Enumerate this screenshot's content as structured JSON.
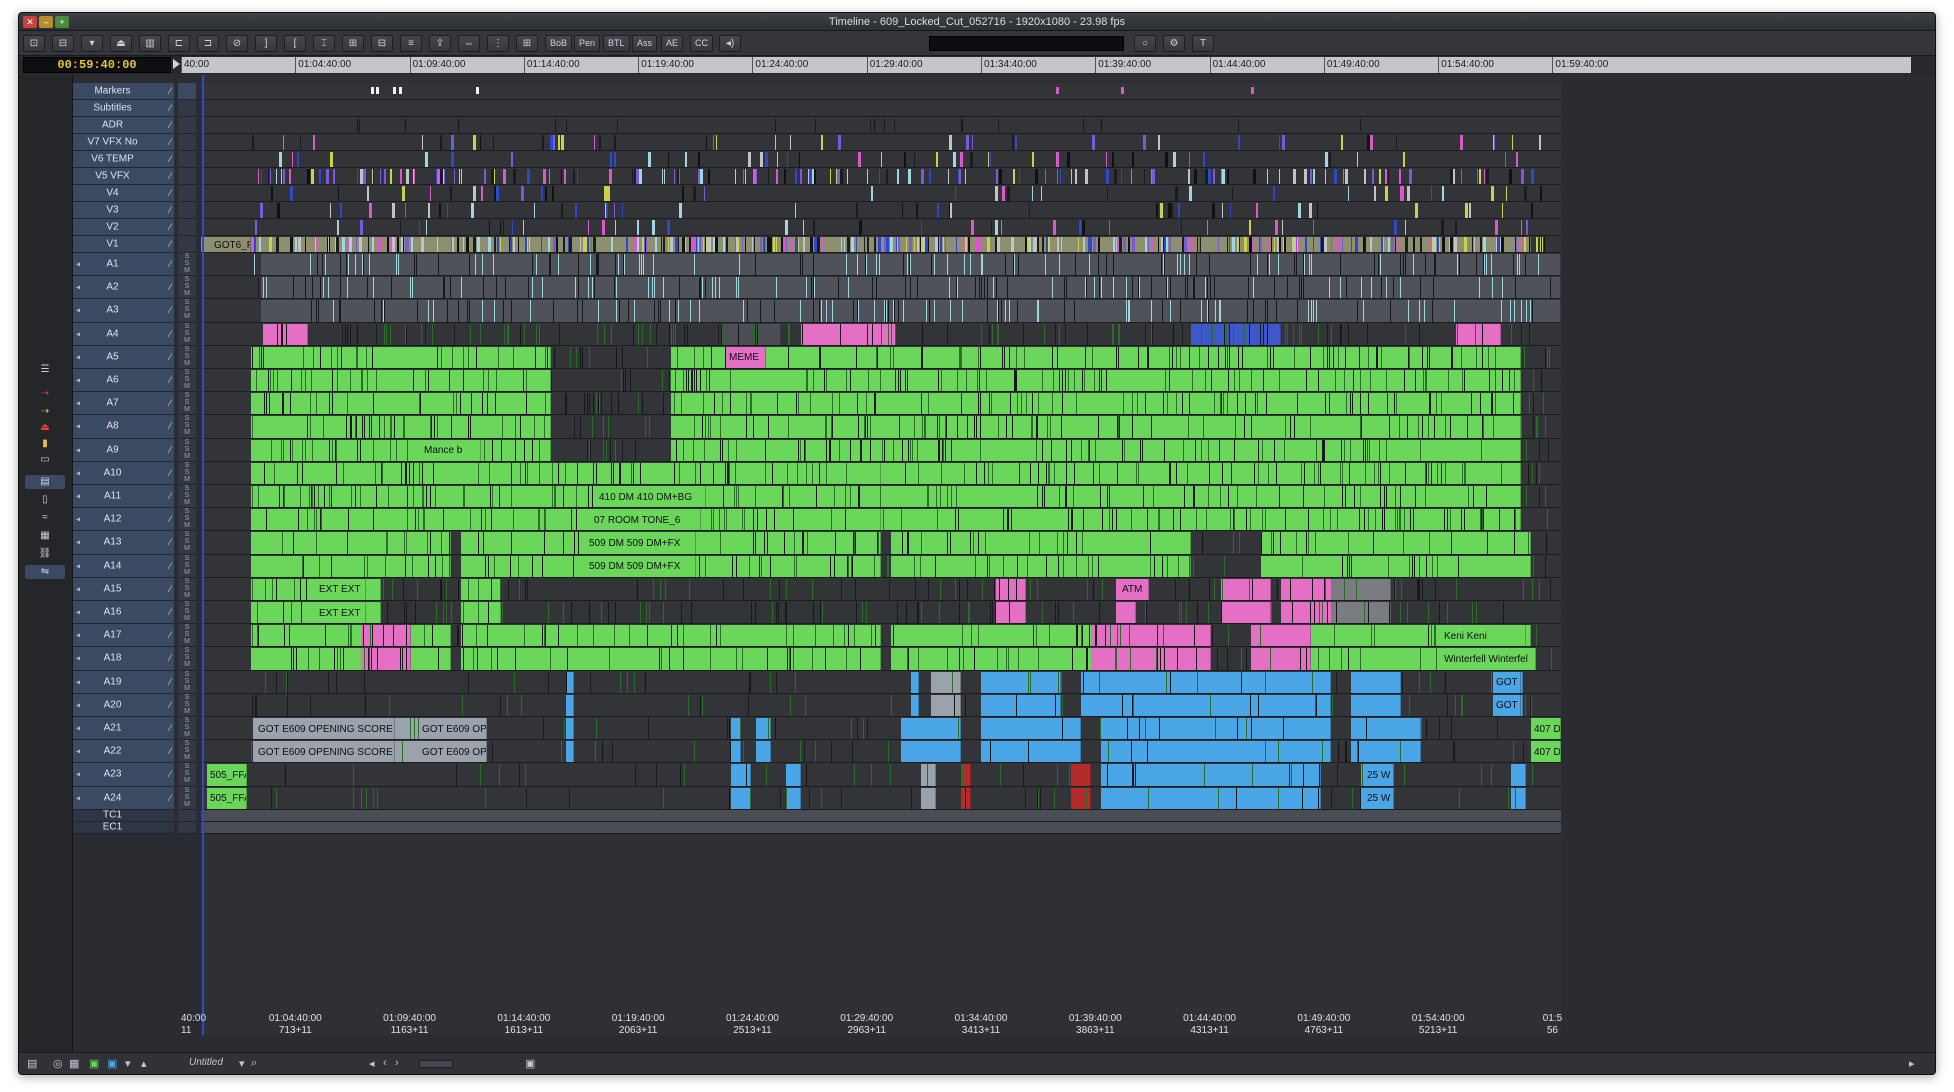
{
  "window": {
    "title": "Timeline - 609_Locked_Cut_052716 - 1920x1080 - 23.98 fps"
  },
  "toolbar": {
    "buttons": [
      {
        "icon": "record-icon"
      },
      {
        "icon": "source-icon"
      },
      {
        "icon": "dropdown-icon"
      },
      {
        "icon": "eject-icon"
      },
      {
        "icon": "film-icon"
      },
      {
        "icon": "splice-icon"
      },
      {
        "icon": "overwrite-icon"
      },
      {
        "icon": "no-entry-icon"
      },
      {
        "icon": "mark-out-icon"
      },
      {
        "icon": "mark-in-icon"
      },
      {
        "icon": "clear-marks-icon"
      },
      {
        "icon": "lift-icon"
      },
      {
        "icon": "extract-icon"
      },
      {
        "icon": "segment-icon"
      },
      {
        "icon": "upload-icon"
      },
      {
        "icon": "trim-icon"
      },
      {
        "icon": "grid-icon"
      },
      {
        "icon": "table-icon"
      },
      {
        "label": "BoB"
      },
      {
        "label": "Pen"
      },
      {
        "label": "BTL"
      },
      {
        "label": "Ass"
      },
      {
        "label": "AE"
      },
      {
        "label": "CC"
      },
      {
        "icon": "speaker-icon"
      },
      {
        "icon": "circle-icon"
      },
      {
        "icon": "settings-icon"
      },
      {
        "icon": "text-tool-icon"
      }
    ]
  },
  "timecode": {
    "value": "00:59:40:00"
  },
  "ruler": {
    "labels": [
      "40:00",
      "01:04:40:00",
      "01:09:40:00",
      "01:14:40:00",
      "01:19:40:00",
      "01:24:40:00",
      "01:29:40:00",
      "01:34:40:00",
      "01:39:40:00",
      "01:44:40:00",
      "01:49:40:00",
      "01:54:40:00",
      "01:59:40:00"
    ]
  },
  "tracks": [
    {
      "name": "Markers",
      "type": "markers"
    },
    {
      "name": "Subtitles",
      "type": "sub"
    },
    {
      "name": "ADR",
      "type": "sub"
    },
    {
      "name": "V7 VFX No",
      "type": "video"
    },
    {
      "name": "V6 TEMP",
      "type": "video"
    },
    {
      "name": "V5 VFX",
      "type": "video"
    },
    {
      "name": "V4",
      "type": "video"
    },
    {
      "name": "V3",
      "type": "video"
    },
    {
      "name": "V2",
      "type": "video"
    },
    {
      "name": "V1",
      "type": "video"
    },
    {
      "name": "A1",
      "type": "audio"
    },
    {
      "name": "A2",
      "type": "audio"
    },
    {
      "name": "A3",
      "type": "audio"
    },
    {
      "name": "A4",
      "type": "audio"
    },
    {
      "name": "A5",
      "type": "audio"
    },
    {
      "name": "A6",
      "type": "audio"
    },
    {
      "name": "A7",
      "type": "audio"
    },
    {
      "name": "A8",
      "type": "audio"
    },
    {
      "name": "A9",
      "type": "audio"
    },
    {
      "name": "A10",
      "type": "audio"
    },
    {
      "name": "A11",
      "type": "audio"
    },
    {
      "name": "A12",
      "type": "audio"
    },
    {
      "name": "A13",
      "type": "audio"
    },
    {
      "name": "A14",
      "type": "audio"
    },
    {
      "name": "A15",
      "type": "audio"
    },
    {
      "name": "A16",
      "type": "audio"
    },
    {
      "name": "A17",
      "type": "audio"
    },
    {
      "name": "A18",
      "type": "audio"
    },
    {
      "name": "A19",
      "type": "audio"
    },
    {
      "name": "A20",
      "type": "audio"
    },
    {
      "name": "A21",
      "type": "audio"
    },
    {
      "name": "A22",
      "type": "audio"
    },
    {
      "name": "A23",
      "type": "audio"
    },
    {
      "name": "A24",
      "type": "audio"
    },
    {
      "name": "TC1",
      "type": "tc"
    },
    {
      "name": "EC1",
      "type": "tc"
    }
  ],
  "clip_labels": [
    {
      "track": "V1",
      "text": "GOT6_F"
    },
    {
      "track": "A5",
      "text": "MEME"
    },
    {
      "track": "A9",
      "text": "Mance b"
    },
    {
      "track": "A11",
      "text": "410 DM 410 DM+BG"
    },
    {
      "track": "A12",
      "text": "07 ROOM TONE_6"
    },
    {
      "track": "A13",
      "text": "509 DM 509 DM+FX"
    },
    {
      "track": "A14",
      "text": "509 DM 509 DM+FX"
    },
    {
      "track": "A15",
      "text": "EXT EXT"
    },
    {
      "track": "A16",
      "text": "EXT EXT"
    },
    {
      "track": "A15",
      "text": "ATM"
    },
    {
      "track": "A17",
      "text": "Keni Keni"
    },
    {
      "track": "A18",
      "text": "Winterfell Winterfel"
    },
    {
      "track": "A21",
      "text": "GOT E609 OPENING SCORE"
    },
    {
      "track": "A22",
      "text": "GOT E609 OPENING SCORE"
    },
    {
      "track": "A21",
      "text": "GOT E609 OPE"
    },
    {
      "track": "A22",
      "text": "GOT E609 OPE"
    },
    {
      "track": "A23",
      "text": "505_FFA"
    },
    {
      "track": "A24",
      "text": "505_FFA"
    },
    {
      "track": "A21",
      "text": "407 D"
    },
    {
      "track": "A22",
      "text": "407 D"
    },
    {
      "track": "A23",
      "text": "25 W"
    },
    {
      "track": "A24",
      "text": "25 W"
    },
    {
      "track": "A19",
      "text": "GOT"
    },
    {
      "track": "A20",
      "text": "GOT"
    }
  ],
  "tc1": {
    "labels": [
      "40:00",
      "01:04:40:00",
      "01:09:40:00",
      "01:14:40:00",
      "01:19:40:00",
      "01:24:40:00",
      "01:29:40:00",
      "01:34:40:00",
      "01:39:40:00",
      "01:44:40:00",
      "01:49:40:00",
      "01:54:40:00",
      "01:5"
    ]
  },
  "ec1": {
    "labels": [
      "11",
      "713+11",
      "1163+11",
      "1613+11",
      "2063+11",
      "2513+11",
      "2963+11",
      "3413+11",
      "3863+11",
      "4313+11",
      "4763+11",
      "5213+11",
      "56"
    ]
  },
  "bottombar": {
    "sequence_name": "Untitled"
  },
  "colors": {
    "green": "#6ad65a",
    "blue": "#4aa6e6",
    "pink": "#e46fc4",
    "gray": "#9aa3ab",
    "header": "#3b4a63",
    "yellow": "#e7c33a"
  }
}
